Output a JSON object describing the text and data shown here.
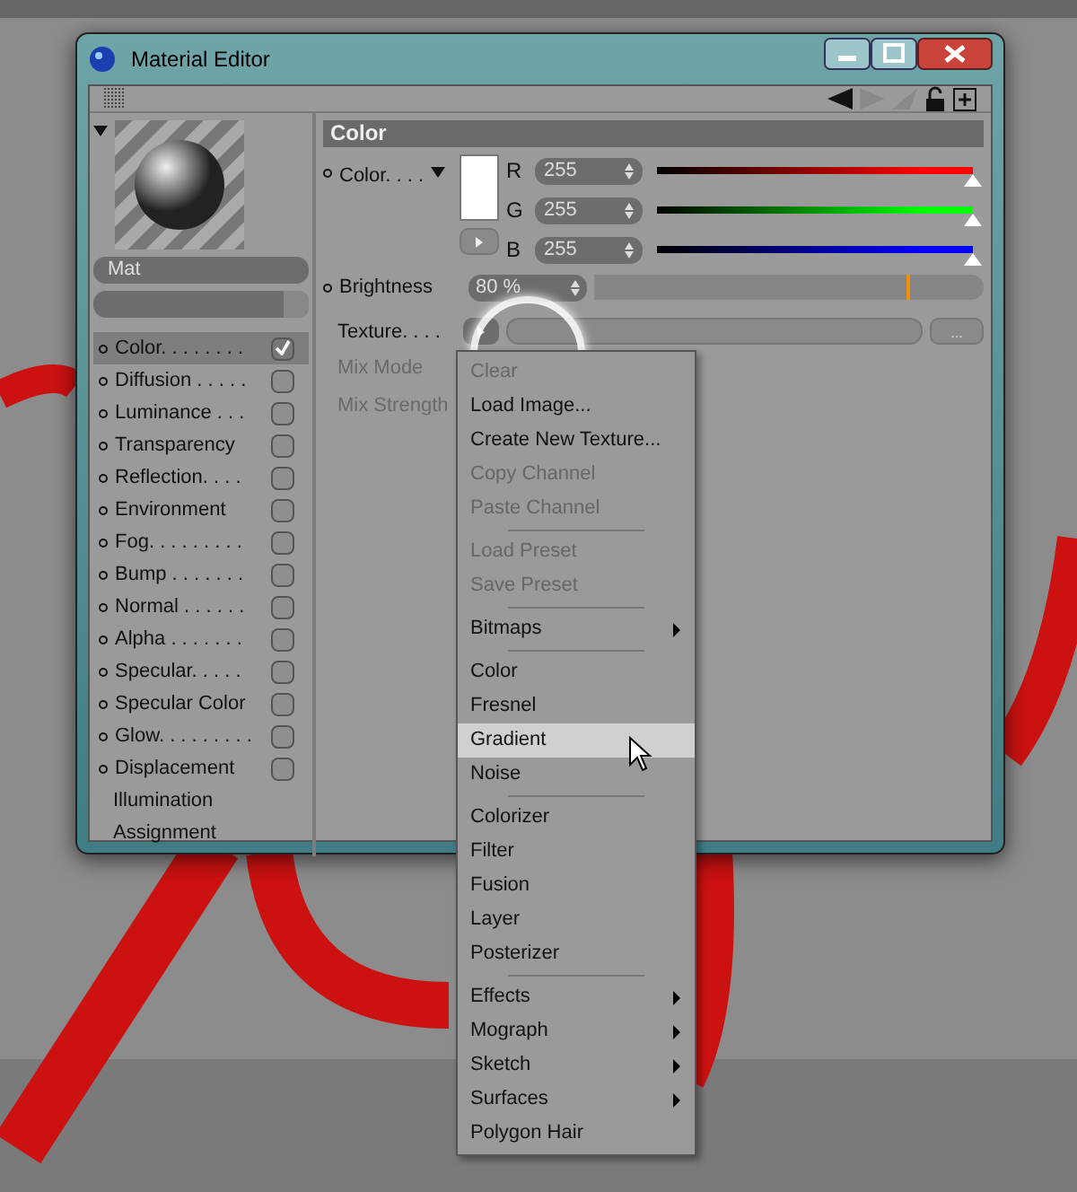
{
  "window": {
    "title": "Material Editor"
  },
  "material": {
    "name": "Mat"
  },
  "channels": [
    {
      "kind": "channel",
      "label": "Color. . . . . . . .",
      "checked": true,
      "selected": true
    },
    {
      "kind": "channel",
      "label": "Diffusion . . . . .",
      "checked": false,
      "selected": false
    },
    {
      "kind": "channel",
      "label": "Luminance . . .",
      "checked": false,
      "selected": false
    },
    {
      "kind": "channel",
      "label": "Transparency",
      "checked": false,
      "selected": false
    },
    {
      "kind": "channel",
      "label": "Reflection. . . .",
      "checked": false,
      "selected": false
    },
    {
      "kind": "channel",
      "label": "Environment",
      "checked": false,
      "selected": false
    },
    {
      "kind": "channel",
      "label": "Fog. . . . . . . . .",
      "checked": false,
      "selected": false
    },
    {
      "kind": "channel",
      "label": "Bump . . . . . . .",
      "checked": false,
      "selected": false
    },
    {
      "kind": "channel",
      "label": "Normal . . . . . .",
      "checked": false,
      "selected": false
    },
    {
      "kind": "channel",
      "label": "Alpha . . . . . . .",
      "checked": false,
      "selected": false
    },
    {
      "kind": "channel",
      "label": "Specular. . . . .",
      "checked": false,
      "selected": false
    },
    {
      "kind": "channel",
      "label": "Specular Color",
      "checked": false,
      "selected": false
    },
    {
      "kind": "channel",
      "label": "Glow. . . . . . . . .",
      "checked": false,
      "selected": false
    },
    {
      "kind": "channel",
      "label": "Displacement",
      "checked": false,
      "selected": false
    },
    {
      "kind": "page",
      "label": "Illumination",
      "selected": false
    },
    {
      "kind": "page",
      "label": "Assignment",
      "selected": false
    }
  ],
  "panel": {
    "title": "Color",
    "color": {
      "label": "Color. . . .",
      "components": [
        {
          "letter": "R",
          "value": "255",
          "level": 1,
          "color": "#ff0000"
        },
        {
          "letter": "G",
          "value": "255",
          "level": 1,
          "color": "#00ff00"
        },
        {
          "letter": "B",
          "value": "255",
          "level": 1,
          "color": "#0000ff"
        }
      ]
    },
    "brightness": {
      "label": "Brightness",
      "value": "80 %",
      "level": 0.8
    },
    "texture": {
      "label": "Texture. . . .",
      "more": "..."
    },
    "mix_mode": {
      "label": "Mix Mode",
      "disabled": true
    },
    "mix_strength": {
      "label": "Mix Strength",
      "disabled": true
    }
  },
  "menu": {
    "items": [
      {
        "kind": "item",
        "label": "Clear",
        "disabled": true,
        "submenu": false,
        "selected": false
      },
      {
        "kind": "item",
        "label": "Load Image...",
        "disabled": false,
        "submenu": false,
        "selected": false
      },
      {
        "kind": "item",
        "label": "Create New Texture...",
        "disabled": false,
        "submenu": false,
        "selected": false
      },
      {
        "kind": "item",
        "label": "Copy Channel",
        "disabled": true,
        "submenu": false,
        "selected": false
      },
      {
        "kind": "item",
        "label": "Paste Channel",
        "disabled": true,
        "submenu": false,
        "selected": false
      },
      {
        "kind": "separator"
      },
      {
        "kind": "item",
        "label": "Load Preset",
        "disabled": true,
        "submenu": false,
        "selected": false
      },
      {
        "kind": "item",
        "label": "Save Preset",
        "disabled": true,
        "submenu": false,
        "selected": false
      },
      {
        "kind": "separator"
      },
      {
        "kind": "item",
        "label": "Bitmaps",
        "disabled": false,
        "submenu": true,
        "selected": false
      },
      {
        "kind": "separator"
      },
      {
        "kind": "item",
        "label": "Color",
        "disabled": false,
        "submenu": false,
        "selected": false
      },
      {
        "kind": "item",
        "label": "Fresnel",
        "disabled": false,
        "submenu": false,
        "selected": false
      },
      {
        "kind": "item",
        "label": "Gradient",
        "disabled": false,
        "submenu": false,
        "selected": true
      },
      {
        "kind": "item",
        "label": "Noise",
        "disabled": false,
        "submenu": false,
        "selected": false
      },
      {
        "kind": "separator"
      },
      {
        "kind": "item",
        "label": "Colorizer",
        "disabled": false,
        "submenu": false,
        "selected": false
      },
      {
        "kind": "item",
        "label": "Filter",
        "disabled": false,
        "submenu": false,
        "selected": false
      },
      {
        "kind": "item",
        "label": "Fusion",
        "disabled": false,
        "submenu": false,
        "selected": false
      },
      {
        "kind": "item",
        "label": "Layer",
        "disabled": false,
        "submenu": false,
        "selected": false
      },
      {
        "kind": "item",
        "label": "Posterizer",
        "disabled": false,
        "submenu": false,
        "selected": false
      },
      {
        "kind": "separator"
      },
      {
        "kind": "item",
        "label": "Effects",
        "disabled": false,
        "submenu": true,
        "selected": false
      },
      {
        "kind": "item",
        "label": "Mograph",
        "disabled": false,
        "submenu": true,
        "selected": false
      },
      {
        "kind": "item",
        "label": "Sketch",
        "disabled": false,
        "submenu": true,
        "selected": false
      },
      {
        "kind": "item",
        "label": "Surfaces",
        "disabled": false,
        "submenu": true,
        "selected": false
      },
      {
        "kind": "item",
        "label": "Polygon Hair",
        "disabled": false,
        "submenu": false,
        "selected": false
      }
    ]
  }
}
